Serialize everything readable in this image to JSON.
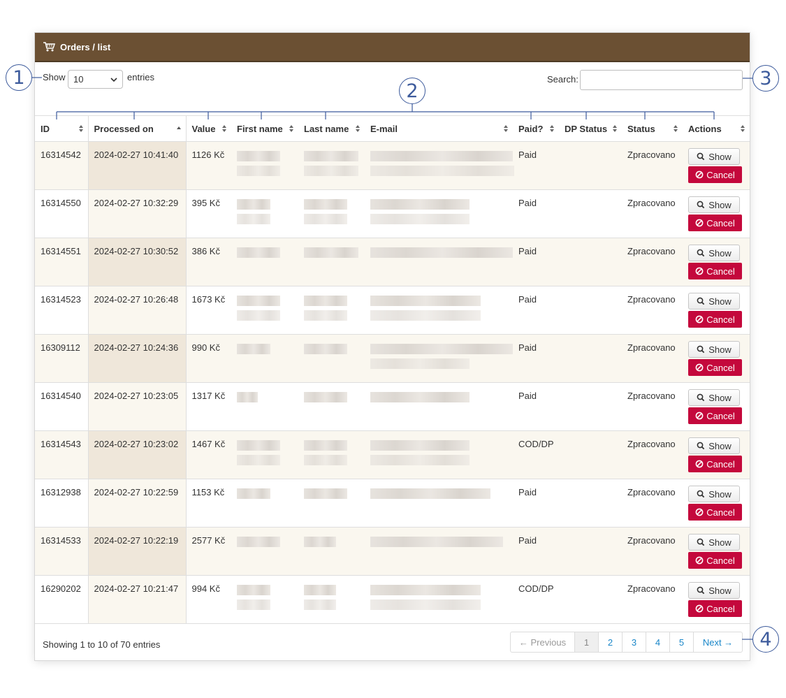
{
  "header": {
    "title": "Orders / list",
    "icon": "shopping-cart-icon"
  },
  "controls": {
    "show_label": "Show",
    "length_value": "10",
    "entries_label": "entries",
    "search_label": "Search:",
    "search_value": ""
  },
  "columns": [
    "ID",
    "Processed on",
    "Value",
    "First name",
    "Last name",
    "E-mail",
    "Paid?",
    "DP Status",
    "Status",
    "Actions"
  ],
  "rows": [
    {
      "id": "16314542",
      "processed": "2024-02-27 10:41:40",
      "value": "1126 Kč",
      "paid": "Paid",
      "dp_status": "",
      "status": "Zpracovano"
    },
    {
      "id": "16314550",
      "processed": "2024-02-27 10:32:29",
      "value": "395 Kč",
      "paid": "Paid",
      "dp_status": "",
      "status": "Zpracovano"
    },
    {
      "id": "16314551",
      "processed": "2024-02-27 10:30:52",
      "value": "386 Kč",
      "paid": "Paid",
      "dp_status": "",
      "status": "Zpracovano"
    },
    {
      "id": "16314523",
      "processed": "2024-02-27 10:26:48",
      "value": "1673 Kč",
      "paid": "Paid",
      "dp_status": "",
      "status": "Zpracovano"
    },
    {
      "id": "16309112",
      "processed": "2024-02-27 10:24:36",
      "value": "990 Kč",
      "paid": "Paid",
      "dp_status": "",
      "status": "Zpracovano"
    },
    {
      "id": "16314540",
      "processed": "2024-02-27 10:23:05",
      "value": "1317 Kč",
      "paid": "Paid",
      "dp_status": "",
      "status": "Zpracovano"
    },
    {
      "id": "16314543",
      "processed": "2024-02-27 10:23:02",
      "value": "1467 Kč",
      "paid": "COD/DP",
      "dp_status": "",
      "status": "Zpracovano"
    },
    {
      "id": "16312938",
      "processed": "2024-02-27 10:22:59",
      "value": "1153 Kč",
      "paid": "Paid",
      "dp_status": "",
      "status": "Zpracovano"
    },
    {
      "id": "16314533",
      "processed": "2024-02-27 10:22:19",
      "value": "2577 Kč",
      "paid": "Paid",
      "dp_status": "",
      "status": "Zpracovano"
    },
    {
      "id": "16290202",
      "processed": "2024-02-27 10:21:47",
      "value": "994 Kč",
      "paid": "COD/DP",
      "dp_status": "",
      "status": "Zpracovano"
    }
  ],
  "actions": {
    "show_label": "Show",
    "cancel_label": "Cancel"
  },
  "footer": {
    "info": "Showing 1 to 10 of 70 entries",
    "prev_label": "← Previous",
    "next_label": "Next →",
    "pages": [
      "1",
      "2",
      "3",
      "4",
      "5"
    ],
    "current_page": "1"
  },
  "callouts": [
    "1",
    "2",
    "3",
    "4"
  ],
  "colors": {
    "header_bg": "#6b5033",
    "cancel_bg": "#c4083c",
    "link": "#1b87c9",
    "callout": "#3d5b9c"
  }
}
